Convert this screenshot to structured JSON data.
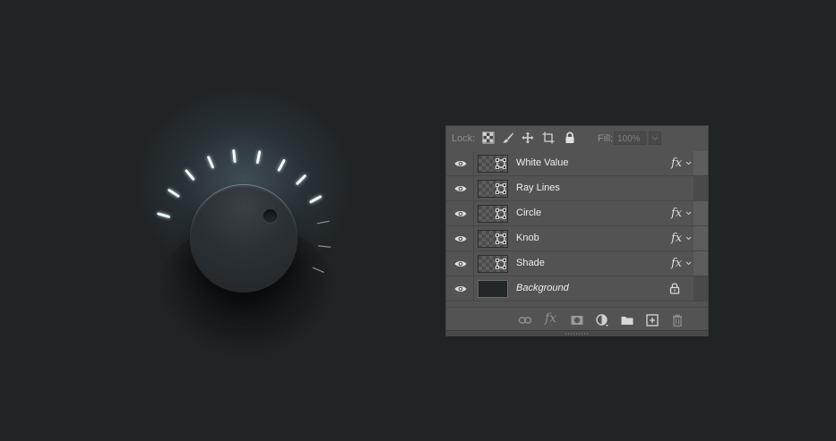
{
  "knob": {
    "ticks_lit": 9,
    "ticks_unlit": 3
  },
  "layers_panel": {
    "lock_label": "Lock:",
    "lock_buttons": [
      "lock-transparent-pixels-icon",
      "lock-image-pixels-icon",
      "lock-position-icon",
      "lock-artboard-icon",
      "lock-all-icon"
    ],
    "fill_label": "Fill:",
    "fill_value": "100%",
    "layers": [
      {
        "name": "White Value",
        "fx": "fx",
        "thumb": "shape",
        "italic": false
      },
      {
        "name": "Ray Lines",
        "fx": "",
        "thumb": "shape",
        "italic": false
      },
      {
        "name": "Circle",
        "fx": "fx",
        "thumb": "shape",
        "italic": false
      },
      {
        "name": "Knob",
        "fx": "fx",
        "thumb": "shape",
        "italic": false
      },
      {
        "name": "Shade",
        "fx": "fx",
        "thumb": "shape",
        "italic": false
      },
      {
        "name": "Background",
        "fx": "",
        "thumb": "solid",
        "italic": true,
        "locked": true
      }
    ],
    "footer_fx": "fx",
    "footer_buttons": [
      "link-layers-icon",
      "add-layer-style-icon",
      "add-mask-icon",
      "new-adjustment-layer-icon",
      "new-group-icon",
      "new-layer-icon",
      "delete-layer-icon"
    ]
  },
  "colors": {
    "background": "#202427",
    "panel": "#535353",
    "tick_lit": "#f2f8fc",
    "tick_unlit": "#8c9398"
  }
}
